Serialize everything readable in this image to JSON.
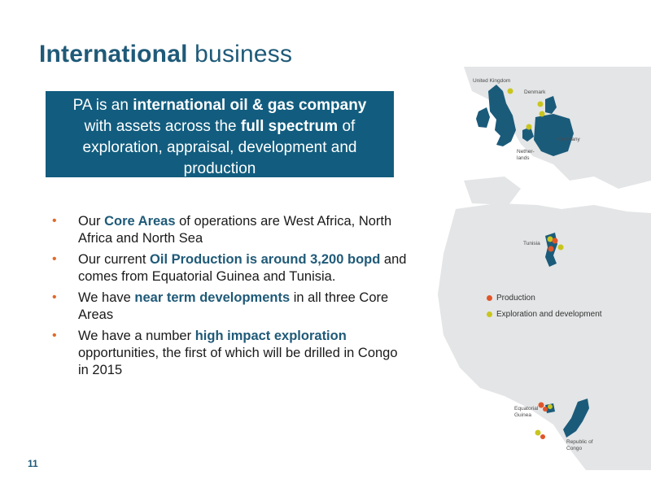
{
  "title": {
    "bold": "International",
    "rest": "business"
  },
  "callout": {
    "p1": "PA is an ",
    "b1": "international oil & gas company",
    "p2": " with assets across the ",
    "b2": "full spectrum",
    "p3": " of exploration, appraisal, development and production"
  },
  "bullets": [
    {
      "pre": "Our ",
      "hl": "Core Areas",
      "post": " of operations are West Africa, North Africa and North Sea"
    },
    {
      "pre": "Our current ",
      "hl": "Oil Production is around 3,200 bopd",
      "post": " and comes from Equatorial Guinea and Tunisia."
    },
    {
      "pre": "We have ",
      "hl": "near term developments",
      "post": " in all three Core Areas"
    },
    {
      "pre": "We have a number ",
      "hl": "high impact exploration",
      "post": " opportunities, the first of which will be drilled in Congo in 2015"
    }
  ],
  "bullet_symbol": "•",
  "legend": {
    "production": "Production",
    "exploration": "Exploration and development"
  },
  "map_labels": {
    "uk": "United Kingdom",
    "denmark": "Denmark",
    "germany": "Germany",
    "netherlands_1": "Nether-",
    "netherlands_2": "lands",
    "tunisia": "Tunisia",
    "eq_guinea_1": "Equatorial",
    "eq_guinea_2": "Guinea",
    "congo_1": "Republic of",
    "congo_2": "Congo"
  },
  "page_number": "11",
  "colors": {
    "brand": "#1f5a78",
    "callout_bg": "#125d7f",
    "bullet": "#e06a2a",
    "production": "#e0562a",
    "exploration": "#c9c51f",
    "land": "#e3e5e6",
    "highlight_country": "#1b5b7a"
  }
}
